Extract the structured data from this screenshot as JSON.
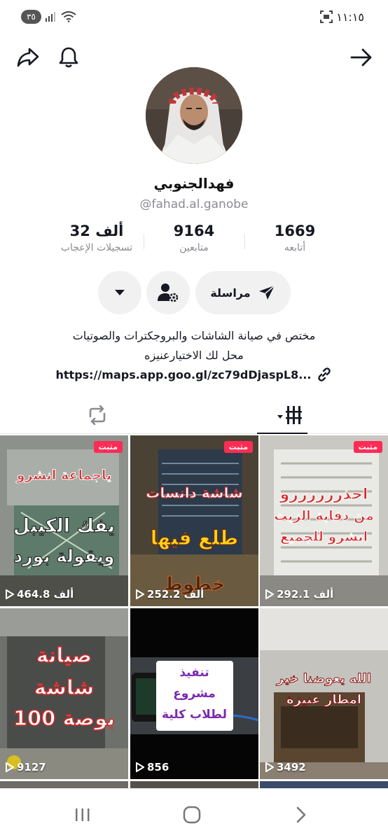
{
  "status_bar": {
    "time": "١١:١٥",
    "battery": "٣٥",
    "icons": [
      "screenshot-icon",
      "wifi-icon",
      "signal-icon"
    ]
  },
  "top_nav": {
    "icons": [
      "back-arrow-icon",
      "bell-icon",
      "share-icon"
    ]
  },
  "profile": {
    "display_name": "فهدالجنوبي",
    "username": "@fahad.al.ganobe"
  },
  "stats": {
    "following_value": "1669",
    "following_label": "أتابعه",
    "followers_value": "9164",
    "followers_label": "متابعين",
    "likes_value": "32 ألف",
    "likes_label": "تسجيلات الإعجاب"
  },
  "actions": {
    "message_label": "مراسلة",
    "icons": [
      "send-icon",
      "user-settings-icon",
      "dropdown-caret-icon"
    ]
  },
  "bio": {
    "line1": "مختص في صيانة  الشاشات والبروجكترات والصوتيات",
    "line2": "محل لك الاختيارعنيزه",
    "link": "https://maps.app.goo.gl/zc79dDjaspL8..."
  },
  "tabs": {
    "icons": [
      "grid-icon",
      "repost-icon"
    ]
  },
  "videos": [
    {
      "pinned": "مثبت",
      "views": "292.1 ألف",
      "caption": [
        "احذررررررو",
        "من دفاية الزيت",
        "انشرو للجميع"
      ]
    },
    {
      "pinned": "مثبت",
      "views": "252.2 ألف",
      "caption": [
        "شاشة دانسات",
        "طلع فيها",
        "خطوط"
      ]
    },
    {
      "pinned": "مثبت",
      "views": "464.8 ألف",
      "caption": [
        "ياجماعة انشرو",
        "يفك الكيبل",
        "ويقولة بورد"
      ]
    },
    {
      "views": "3492",
      "caption": [
        "الله يعوضنا خير",
        "امطار عنيزة"
      ]
    },
    {
      "views": "856",
      "caption": [
        "تنفيذ",
        "مشروع",
        "لطلاب كلية"
      ]
    },
    {
      "views": "9127",
      "caption": [
        "صيانة",
        "شاشة",
        "100 بوصة"
      ]
    }
  ],
  "colors": {
    "pinned_badge": "#fe2c55",
    "text_primary": "#161823",
    "text_secondary": "#8a8b91",
    "button_bg": "#f1f1f2"
  },
  "system_nav": {
    "icons": [
      "recent-apps-icon",
      "home-icon",
      "back-icon"
    ]
  }
}
